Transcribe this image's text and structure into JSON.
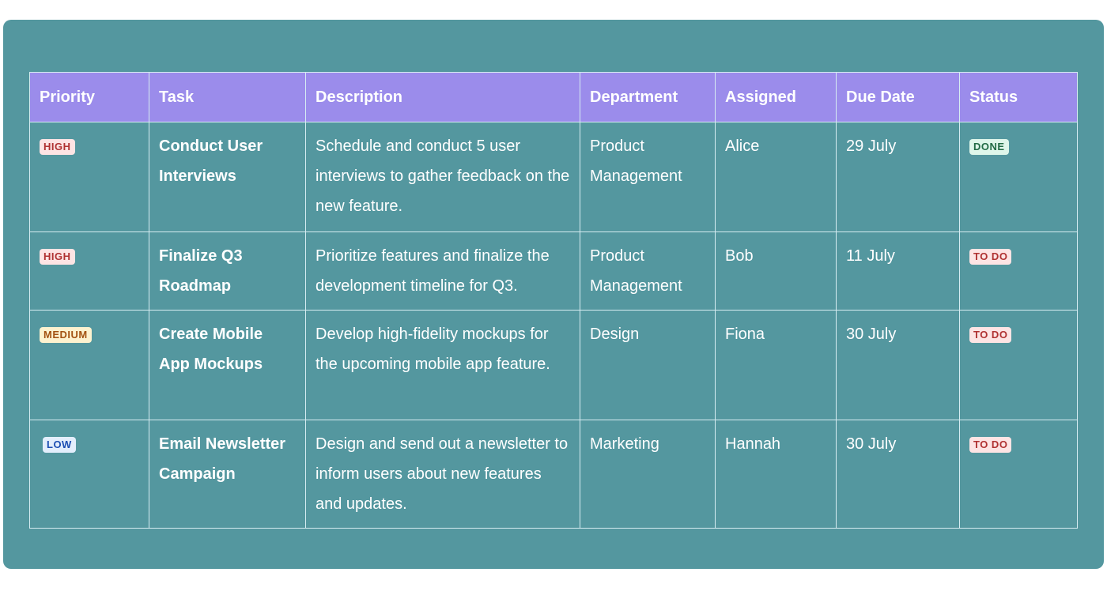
{
  "table": {
    "headers": [
      "Priority",
      "Task",
      "Description",
      "Department",
      "Assigned",
      "Due Date",
      "Status"
    ],
    "rows": [
      {
        "priority": "HIGH",
        "task": "Conduct User Interviews",
        "description": "Schedule and conduct 5 user interviews to gather feedback on the new feature.",
        "department": "Product Management",
        "assigned": "Alice",
        "due_date": "29 July",
        "status": "DONE"
      },
      {
        "priority": "HIGH",
        "task": "Finalize Q3 Roadmap",
        "description": "Prioritize features and finalize the development timeline for Q3.",
        "department": "Product Management",
        "assigned": "Bob",
        "due_date": "11 July",
        "status": "TO DO"
      },
      {
        "priority": "MEDIUM",
        "task": "Create Mobile App Mockups",
        "description": "Develop high-fidelity mockups for the upcoming mobile app feature.",
        "department": "Design",
        "assigned": "Fiona",
        "due_date": "30 July",
        "status": "TO DO"
      },
      {
        "priority": "LOW",
        "task": "Email Newsletter Campaign",
        "description": "Design and send out a newsletter to inform users about new features and updates.",
        "department": "Marketing",
        "assigned": "Hannah",
        "due_date": "30 July",
        "status": "TO DO"
      }
    ]
  },
  "colors": {
    "card_background": "#54979f",
    "header_background": "#9b8ceb",
    "grid_lines": "#d6ecf2",
    "high": "#b03232",
    "medium": "#a35212",
    "low": "#1d4fb3",
    "done": "#226b45",
    "todo": "#b03232"
  }
}
